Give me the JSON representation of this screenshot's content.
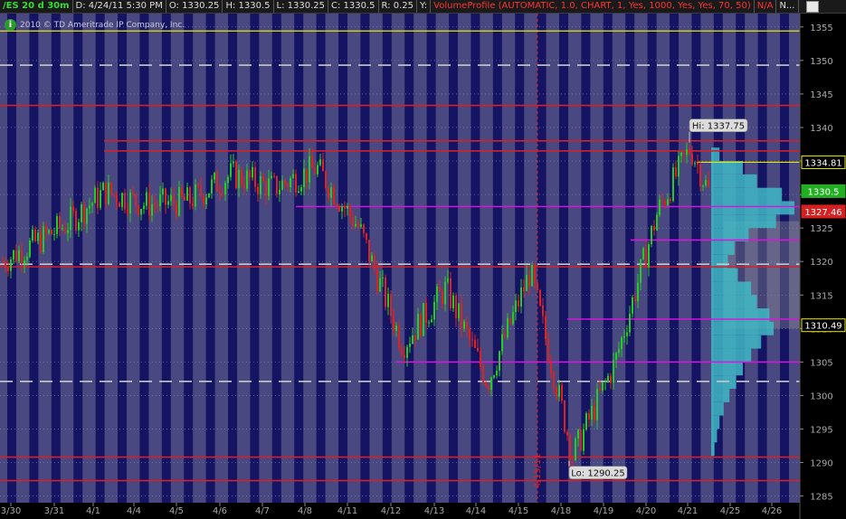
{
  "header": {
    "symbol": "/ES 20 d 30m",
    "date": "D: 4/24/11 5:30 PM",
    "open": "O: 1330.25",
    "high": "H: 1330.5",
    "low": "L: 1330.25",
    "close": "C: 1330.5",
    "range": "R: 0.25",
    "y": "Y:",
    "study": "VolumeProfile (AUTOMATIC, 1.0, CHART, 1, Yes, 1000, Yes, Yes, 70, 50)",
    "na": "N/A",
    "more": "N..."
  },
  "copyright": "2010 © TD Ameritrade IP Company, Inc.",
  "chart_data": {
    "type": "candlestick",
    "y_ticks": [
      1285,
      1290,
      1295,
      1300,
      1305,
      1310,
      1315,
      1320,
      1325,
      1330,
      1335,
      1340,
      1345,
      1350,
      1355
    ],
    "ylim": [
      1284,
      1357
    ],
    "x_ticks": [
      "3/30",
      "3/31",
      "4/1",
      "4/4",
      "4/5",
      "4/6",
      "4/7",
      "4/8",
      "4/11",
      "4/12",
      "4/13",
      "4/14",
      "4/15",
      "4/18",
      "4/19",
      "4/20",
      "4/21",
      "4/25",
      "4/26"
    ],
    "price_tags": [
      {
        "text": "1334.81",
        "value": 1334.81,
        "style": "outline-yellow"
      },
      {
        "text": "1330.5",
        "value": 1330.5,
        "style": "green"
      },
      {
        "text": "1327.46",
        "value": 1327.46,
        "style": "red"
      },
      {
        "text": "1310.49",
        "value": 1310.49,
        "style": "outline-yellow"
      }
    ],
    "annotations": [
      {
        "text": "Hi: 1337.75",
        "date": "4/21",
        "value": 1337.75
      },
      {
        "text": "Lo: 1290.25",
        "date": "4/18",
        "value": 1290.25
      }
    ],
    "vertical_label": {
      "text": "4/15/11",
      "date": "4/15"
    },
    "horizontal_lines": {
      "yellow": [
        1354.4
      ],
      "white_dashed": [
        1349.3,
        1319.6,
        1302.1
      ],
      "red": [
        1343.3,
        1338.0,
        1336.5,
        1319.2,
        1290.8,
        1287.3
      ],
      "magenta": [
        1328.2,
        1323.2,
        1311.4,
        1305.0
      ],
      "yellow_short": [
        1334.81
      ]
    },
    "price_path": [
      {
        "date": "3/30",
        "value": 1320.0
      },
      {
        "date": "3/31",
        "value": 1325.5
      },
      {
        "date": "4/1",
        "value": 1330.5
      },
      {
        "date": "4/4",
        "value": 1328.5
      },
      {
        "date": "4/5",
        "value": 1329.0
      },
      {
        "date": "4/6",
        "value": 1333.0
      },
      {
        "date": "4/7",
        "value": 1331.0
      },
      {
        "date": "4/8",
        "value": 1334.0
      },
      {
        "date": "4/11",
        "value": 1325.0
      },
      {
        "date": "4/12",
        "value": 1307.5
      },
      {
        "date": "4/13",
        "value": 1316.0
      },
      {
        "date": "4/14",
        "value": 1302.0
      },
      {
        "date": "4/15",
        "value": 1318.5
      },
      {
        "date": "4/18",
        "value": 1291.0
      },
      {
        "date": "4/19",
        "value": 1305.0
      },
      {
        "date": "4/20",
        "value": 1327.5
      },
      {
        "date": "4/21",
        "value": 1337.0
      },
      {
        "date": "4/21",
        "value": 1330.5
      }
    ],
    "volume_profile": [
      {
        "price": 1336,
        "volume": 0.1
      },
      {
        "price": 1334,
        "volume": 0.38
      },
      {
        "price": 1332,
        "volume": 0.55
      },
      {
        "price": 1330,
        "volume": 0.85
      },
      {
        "price": 1328,
        "volume": 1.0
      },
      {
        "price": 1326,
        "volume": 0.78
      },
      {
        "price": 1324,
        "volume": 0.45
      },
      {
        "price": 1322,
        "volume": 0.28
      },
      {
        "price": 1320,
        "volume": 0.2
      },
      {
        "price": 1318,
        "volume": 0.32
      },
      {
        "price": 1316,
        "volume": 0.48
      },
      {
        "price": 1314,
        "volume": 0.55
      },
      {
        "price": 1312,
        "volume": 0.7
      },
      {
        "price": 1310,
        "volume": 0.75
      },
      {
        "price": 1308,
        "volume": 0.6
      },
      {
        "price": 1306,
        "volume": 0.48
      },
      {
        "price": 1304,
        "volume": 0.38
      },
      {
        "price": 1302,
        "volume": 0.3
      },
      {
        "price": 1300,
        "volume": 0.22
      },
      {
        "price": 1298,
        "volume": 0.15
      },
      {
        "price": 1296,
        "volume": 0.1
      },
      {
        "price": 1294,
        "volume": 0.07
      },
      {
        "price": 1292,
        "volume": 0.04
      }
    ],
    "colors": {
      "background_band_light": "#4a4880",
      "background_band_dark": "#151463",
      "up": "#22cc22",
      "down": "#dd2222",
      "red_line": "#d4202a",
      "magenta_line": "#e010e0",
      "yellow_line": "#e8e800",
      "dashed_line": "#c8c8c8",
      "profile": "#3fb8c6"
    }
  }
}
